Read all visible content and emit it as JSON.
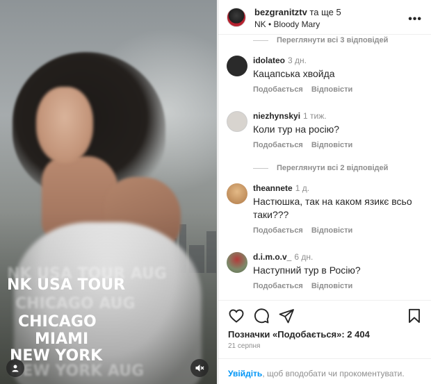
{
  "media": {
    "overlay_lines": [
      "NK USA TOUR",
      "CHICAGO",
      "MIAMI",
      "NEW YORK"
    ],
    "ghost_lines": [
      "NK USA TOUR AUG",
      "CHICAGO AUG",
      "NEW YORK AUG"
    ]
  },
  "header": {
    "username": "bezgranitztv",
    "and_more": "та ще 5",
    "audio": "NK • Bloody Mary",
    "more_icon": "more-horizontal-icon"
  },
  "comments": [
    {
      "view_replies": "Переглянути всі 3 відповідей"
    },
    {
      "user": "idolateo",
      "time": "3 дн.",
      "text": "Кацапська хвойда",
      "like": "Подобається",
      "reply": "Відповісти",
      "avatar_color": "#2a2a2a"
    },
    {
      "user": "niezhynskyi",
      "time": "1 тиж.",
      "text": "Коли тур на росію?",
      "like": "Подобається",
      "reply": "Відповісти",
      "avatar_color": "#d8d4cf"
    },
    {
      "view_replies": "Переглянути всі 2 відповідей"
    },
    {
      "user": "theannete",
      "time": "1 д.",
      "text": "Настюшка, так на каком язикє всьо таки???",
      "like": "Подобається",
      "reply": "Відповісти",
      "avatar_color": "#c89a64"
    },
    {
      "user": "d.i.m.o.v_",
      "time": "6 дн.",
      "text": "Наступний тур в Росію?",
      "like": "Подобається",
      "reply": "Відповісти",
      "avatar_color": "#7c8a6a"
    }
  ],
  "actions": {
    "likes": "Позначки «Подобається»: 2 404",
    "date": "21 серпня",
    "icons": [
      "heart-icon",
      "comment-icon",
      "share-icon",
      "bookmark-icon"
    ]
  },
  "footer": {
    "login_link": "Увійдіть",
    "rest": ", щоб вподобати чи прокоментувати."
  }
}
